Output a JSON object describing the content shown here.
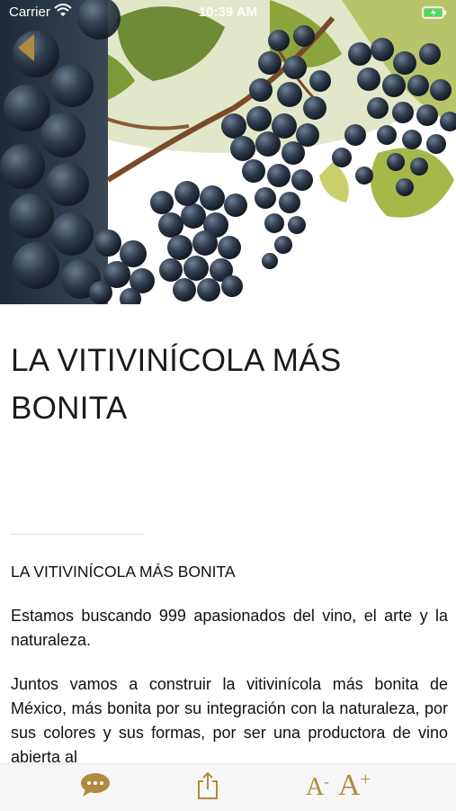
{
  "status_bar": {
    "carrier": "Carrier",
    "time": "10:39 AM"
  },
  "hero": {
    "icons": {
      "back": "back-arrow-icon"
    }
  },
  "article": {
    "title": "LA VITIVINÍCOLA MÁS BONITA",
    "subtitle": "LA VITIVINÍCOLA MÁS BONITA",
    "paragraphs": [
      "Estamos buscando 999 apasionados del vino, el arte y la naturaleza.",
      "Juntos vamos a construir la vitivinícola más bonita de México, más bonita por su integración con la naturaleza, por sus colores y sus formas, por ser una productora de vino abierta al"
    ]
  },
  "toolbar": {
    "decrease_font_label": "A",
    "decrease_font_sign": "-",
    "increase_font_label": "A",
    "increase_font_sign": "+",
    "icons": {
      "comment": "speech-bubble-icon",
      "share": "share-icon"
    }
  },
  "colors": {
    "accent": "#b08a3e",
    "toolbar_background": "#f7f7f7"
  }
}
